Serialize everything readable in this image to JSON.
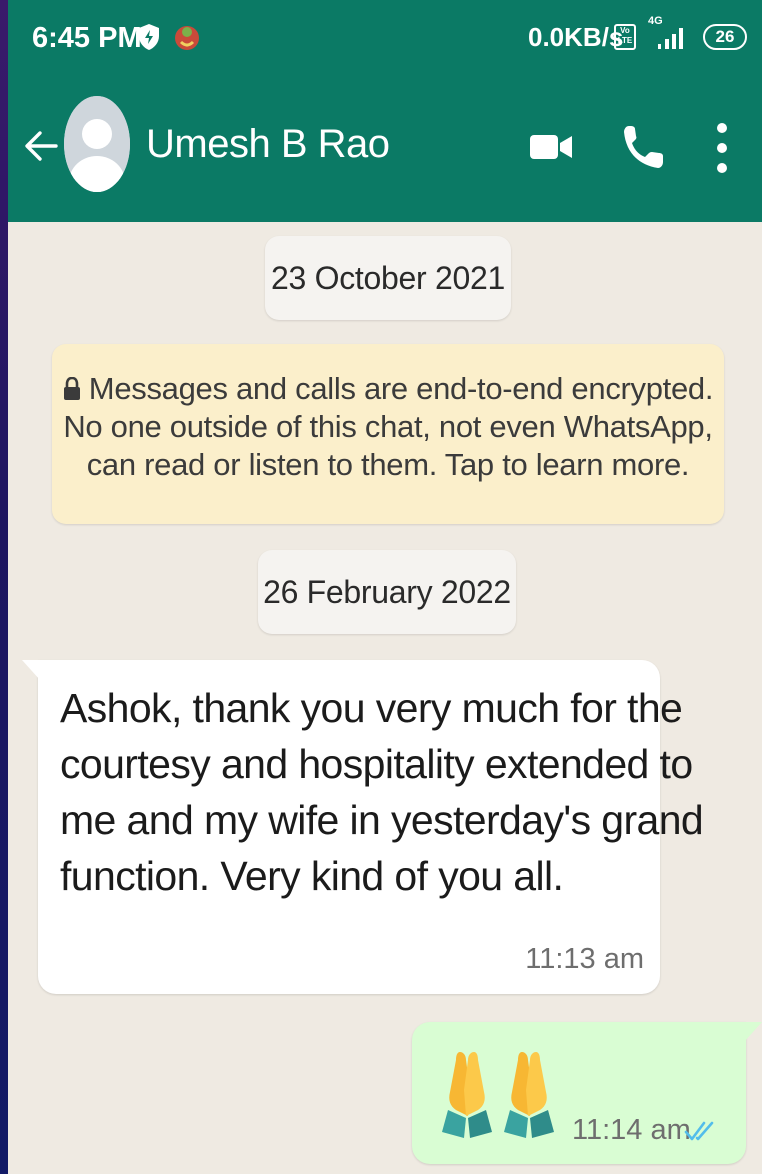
{
  "status_bar": {
    "time": "6:45 PM",
    "network_speed": "0.0KB/s",
    "volte_label": "Vo LTE",
    "network_type": "4G",
    "battery": "26"
  },
  "header": {
    "contact_name": "Umesh B Rao",
    "icons": [
      "back-arrow-icon",
      "avatar",
      "video-call-icon",
      "voice-call-icon",
      "more-options-icon"
    ],
    "colors": {
      "header_bg": "#0b7a65",
      "chat_bg": "#efeae2"
    }
  },
  "chat": {
    "date_1": "23 October 2021",
    "encryption_notice": {
      "line_1": "Messages and calls are end-to-end encrypted.",
      "line_2": "No one outside of this chat, not even WhatsApp,",
      "line_3": "can read or listen to them. Tap to learn more."
    },
    "date_2": "26 February 2022",
    "incoming": {
      "lines": [
        "Ashok, thank you very much for the",
        "courtesy and hospitality extended to",
        "me and my wife in yesterday's grand",
        "function. Very kind of you all."
      ],
      "time": "11:13 am"
    },
    "outgoing": {
      "content": "🙏🙏",
      "time": "11:14 am",
      "status": "read",
      "colors": {
        "bubble_bg": "#d9fdd3",
        "tick_color": "#53bdeb"
      }
    }
  }
}
